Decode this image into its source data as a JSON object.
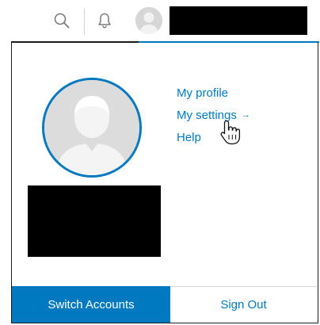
{
  "topbar": {
    "search_icon": "search-icon",
    "notification_icon": "bell-icon",
    "avatar_icon": "user-avatar-icon",
    "username_redacted": true
  },
  "profile": {
    "avatar_icon": "user-avatar-icon",
    "name_redacted": true
  },
  "menu": {
    "items": [
      {
        "label": "My profile"
      },
      {
        "label": "My settings",
        "arrow": "→"
      },
      {
        "label": "Help"
      }
    ]
  },
  "footer": {
    "switch_accounts_label": "Switch Accounts",
    "sign_out_label": "Sign Out"
  },
  "colors": {
    "accent": "#0079c1",
    "text_on_accent": "#ffffff",
    "redaction": "#000000",
    "border": "#1b1b1b"
  }
}
